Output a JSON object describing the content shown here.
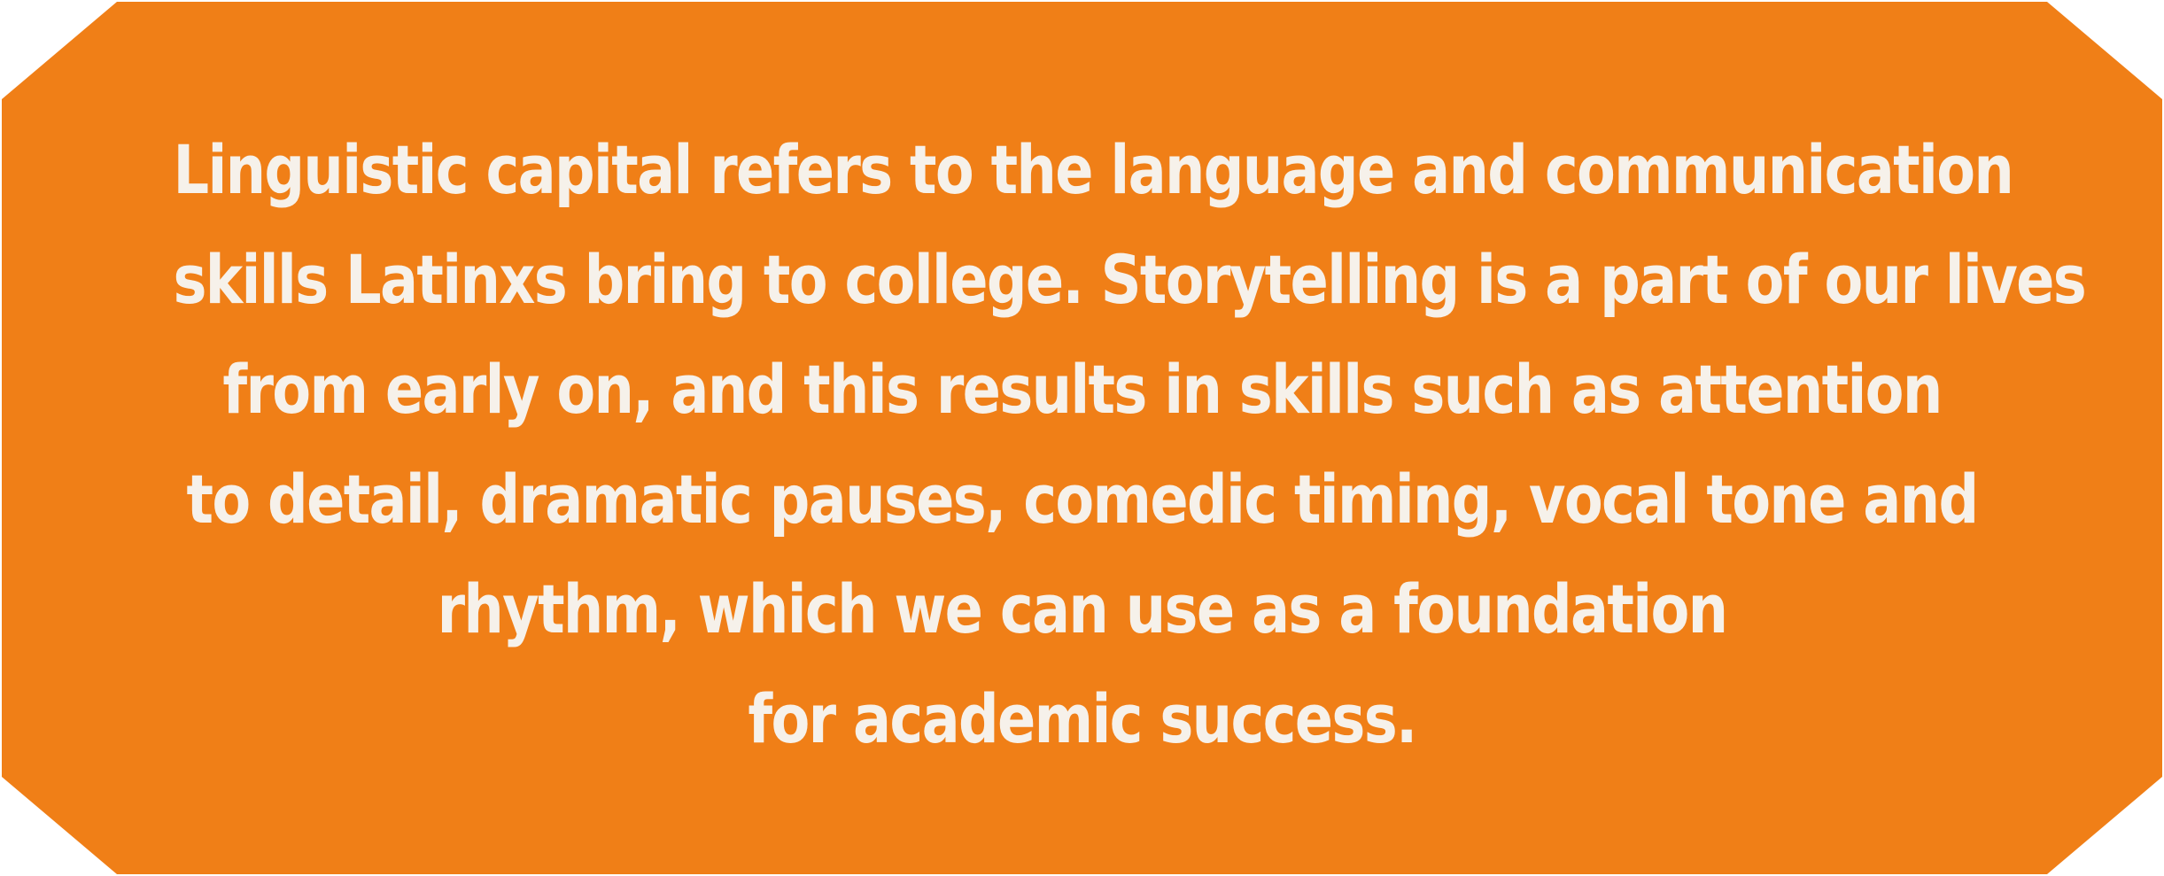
{
  "colors": {
    "card_background": "#f07f17",
    "text": "#f6f1ea"
  },
  "paragraph": {
    "lines": [
      "Linguistic capital refers to the language and communication",
      "skills Latinxs bring to college.  Storytelling is a part of our lives",
      "from early on, and this results in skills such as attention",
      "to detail, dramatic pauses, comedic timing, vocal tone and",
      "rhythm, which we can use as a foundation",
      "for academic success."
    ]
  }
}
